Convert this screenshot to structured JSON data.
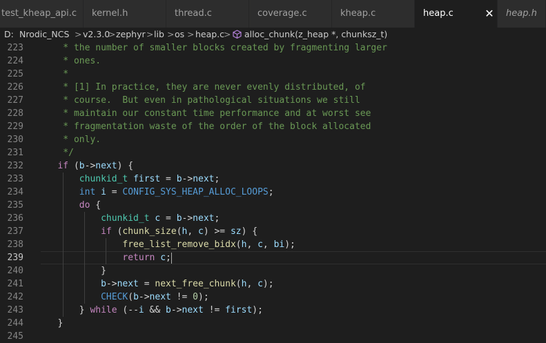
{
  "tabs": [
    {
      "label": "test_kheap_api.c",
      "active": false,
      "italic": false
    },
    {
      "label": "kernel.h",
      "active": false,
      "italic": false
    },
    {
      "label": "thread.c",
      "active": false,
      "italic": false
    },
    {
      "label": "coverage.c",
      "active": false,
      "italic": false
    },
    {
      "label": "kheap.c",
      "active": false,
      "italic": false
    },
    {
      "label": "heap.c",
      "active": true,
      "italic": false
    },
    {
      "label": "heap.h",
      "active": false,
      "italic": true
    }
  ],
  "close_glyph": "✕",
  "breadcrumb": {
    "items": [
      "D:",
      "Nrodic_NCS",
      "v2.3.0",
      "zephyr",
      "lib",
      "os",
      "heap.c"
    ],
    "symbol": "alloc_chunk(z_heap *, chunksz_t)",
    "separator": ">"
  },
  "editor": {
    "line_numbers": [
      "223",
      "224",
      "225",
      "226",
      "227",
      "228",
      "229",
      "230",
      "231",
      "232",
      "233",
      "234",
      "235",
      "236",
      "237",
      "238",
      "239",
      "240",
      "241",
      "242",
      "243",
      "244",
      "245"
    ],
    "current_line": "239",
    "colors": {
      "comment": "#6a9955",
      "keyword": "#569cd6",
      "type": "#4ec9b0",
      "function": "#dcdcaa",
      "variable": "#9cdcfe"
    },
    "lines": [
      "    * the number of smaller blocks created by fragmenting larger",
      "    * ones.",
      "    *",
      "    * [1] In practice, they are never evenly distributed, of",
      "    * course.  But even in pathological situations we still",
      "    * maintain our constant time performance and at worst see",
      "    * fragmentation waste of the order of the block allocated",
      "    * only.",
      "    */",
      "   if (b->next) {",
      "       chunkid_t first = b->next;",
      "       int i = CONFIG_SYS_HEAP_ALLOC_LOOPS;",
      "       do {",
      "           chunkid_t c = b->next;",
      "           if (chunk_size(h, c) >= sz) {",
      "               free_list_remove_bidx(h, c, bi);",
      "               return c;",
      "           }",
      "           b->next = next_free_chunk(h, c);",
      "           CHECK(b->next != 0);",
      "       } while (--i && b->next != first);",
      "   }",
      ""
    ]
  }
}
